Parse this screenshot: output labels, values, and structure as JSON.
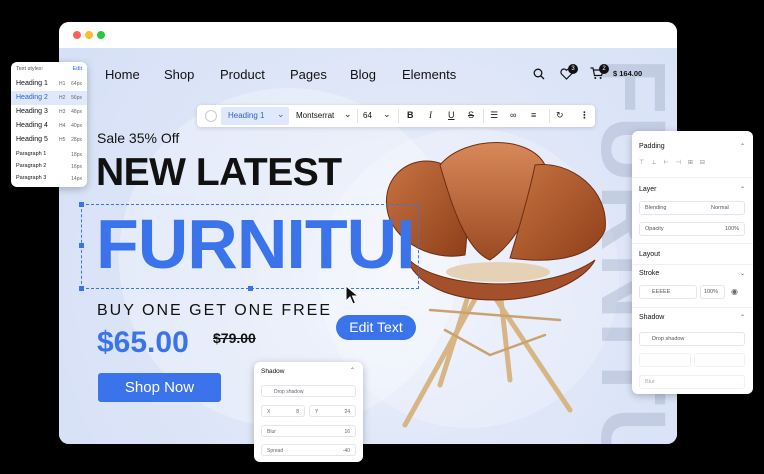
{
  "nav": {
    "items": [
      "Home",
      "Shop",
      "Product",
      "Pages",
      "Blog",
      "Elements"
    ],
    "wishlist_count": "3",
    "cart_count": "2",
    "cart_total": "$ 164.00"
  },
  "toolbar": {
    "style_value": "Heading 1",
    "font_value": "Montserrat",
    "size_value": "64"
  },
  "hero": {
    "sale": "Sale 35% Off",
    "headline": "NEW LATEST",
    "furniture": "FURNITURE",
    "offer": "BUY ONE GET ONE FREE",
    "price": "$65.00",
    "old_price": "$79.00",
    "shop_button": "Shop Now",
    "edit_button": "Edit Text",
    "watermark": "FURNITURE"
  },
  "text_styles": {
    "title": "Text styles:",
    "edit": "Edit",
    "rows": [
      {
        "name": "Heading 1",
        "tag": "H1",
        "size": "64px"
      },
      {
        "name": "Heading 2",
        "tag": "H2",
        "size": "56px"
      },
      {
        "name": "Heading 3",
        "tag": "H3",
        "size": "48px"
      },
      {
        "name": "Heading 4",
        "tag": "H4",
        "size": "40px"
      },
      {
        "name": "Heading 5",
        "tag": "H5",
        "size": "28px"
      },
      {
        "name": "Paragraph 1",
        "tag": "",
        "size": "18px"
      },
      {
        "name": "Paragraph 2",
        "tag": "",
        "size": "16px"
      },
      {
        "name": "Paragraph 3",
        "tag": "",
        "size": "14px"
      }
    ]
  },
  "props": {
    "padding": "Padding",
    "layer": "Layer",
    "blending": "Blending",
    "blending_value": "Normal",
    "opacity": "Opacity",
    "opacity_value": "100%",
    "layout": "Layout",
    "stroke": "Stroke",
    "stroke_color": "EEEEE",
    "stroke_value": "100%",
    "shadow": "Shadow",
    "drop_shadow": "Drop shadow",
    "blur": "Blur"
  },
  "shadow_popup": {
    "title": "Shadow",
    "type": "Drop shadow",
    "x_label": "X",
    "x_value": "8",
    "y_label": "Y",
    "y_value": "24",
    "blur_label": "Blur",
    "blur_value": "16",
    "spread_label": "Spread",
    "spread_value": "-40"
  },
  "colors": {
    "accent": "#3b73ea",
    "chair_leather": "#b85d2c",
    "chair_wood": "#d9b98a",
    "background": "#dfe7f9"
  }
}
